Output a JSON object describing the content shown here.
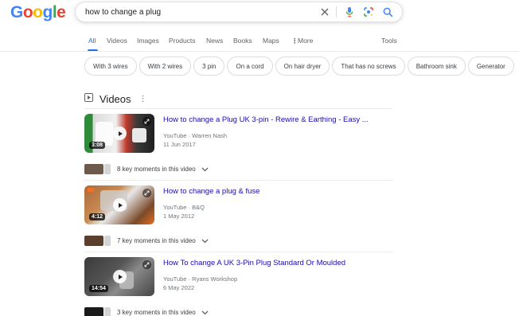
{
  "logo": {
    "letters": [
      "G",
      "o",
      "o",
      "g",
      "l",
      "e"
    ],
    "colors": [
      "#4285f4",
      "#ea4335",
      "#fbbc05",
      "#4285f4",
      "#34a853",
      "#ea4335"
    ]
  },
  "search": {
    "value": "how to change a plug",
    "clear_icon": "close-icon",
    "mic_icon": "mic-icon",
    "lens_icon": "lens-icon",
    "search_icon": "search-icon"
  },
  "tabs": [
    {
      "label": "All",
      "active": true
    },
    {
      "label": "Videos"
    },
    {
      "label": "Images"
    },
    {
      "label": "Products"
    },
    {
      "label": "News"
    },
    {
      "label": "Books"
    },
    {
      "label": "Maps"
    },
    {
      "label": "More"
    },
    {
      "label": "Tools"
    }
  ],
  "chips": [
    "With 3 wires",
    "With 2 wires",
    "3 pin",
    "On a cord",
    "On hair dryer",
    "That has no screws",
    "Bathroom sink",
    "Generator"
  ],
  "videos": {
    "title": "Videos",
    "more_icon": "more-vert-icon",
    "items": [
      {
        "title": "How to change a Plug UK 3-pin - Rewire & Earthing - Easy ...",
        "source": "YouTube",
        "channel": "Warren Nash",
        "date": "11 Jun 2017",
        "duration": "3:08",
        "key_moments": "8 key moments in this video"
      },
      {
        "title": "How to change a plug & fuse",
        "source": "YouTube",
        "channel": "B&Q",
        "date": "1 May 2012",
        "duration": "4:12",
        "key_moments": "7 key moments in this video"
      },
      {
        "title": "How To change A UK 3-Pin Plug Standard Or Moulded",
        "source": "YouTube",
        "channel": "Ryans Workshop",
        "date": "6 May 2022",
        "duration": "14:54",
        "key_moments": "3 key moments in this video"
      }
    ]
  },
  "colors": {
    "link": "#1a0dab",
    "accent": "#1a73e8",
    "meta": "#70757a"
  }
}
